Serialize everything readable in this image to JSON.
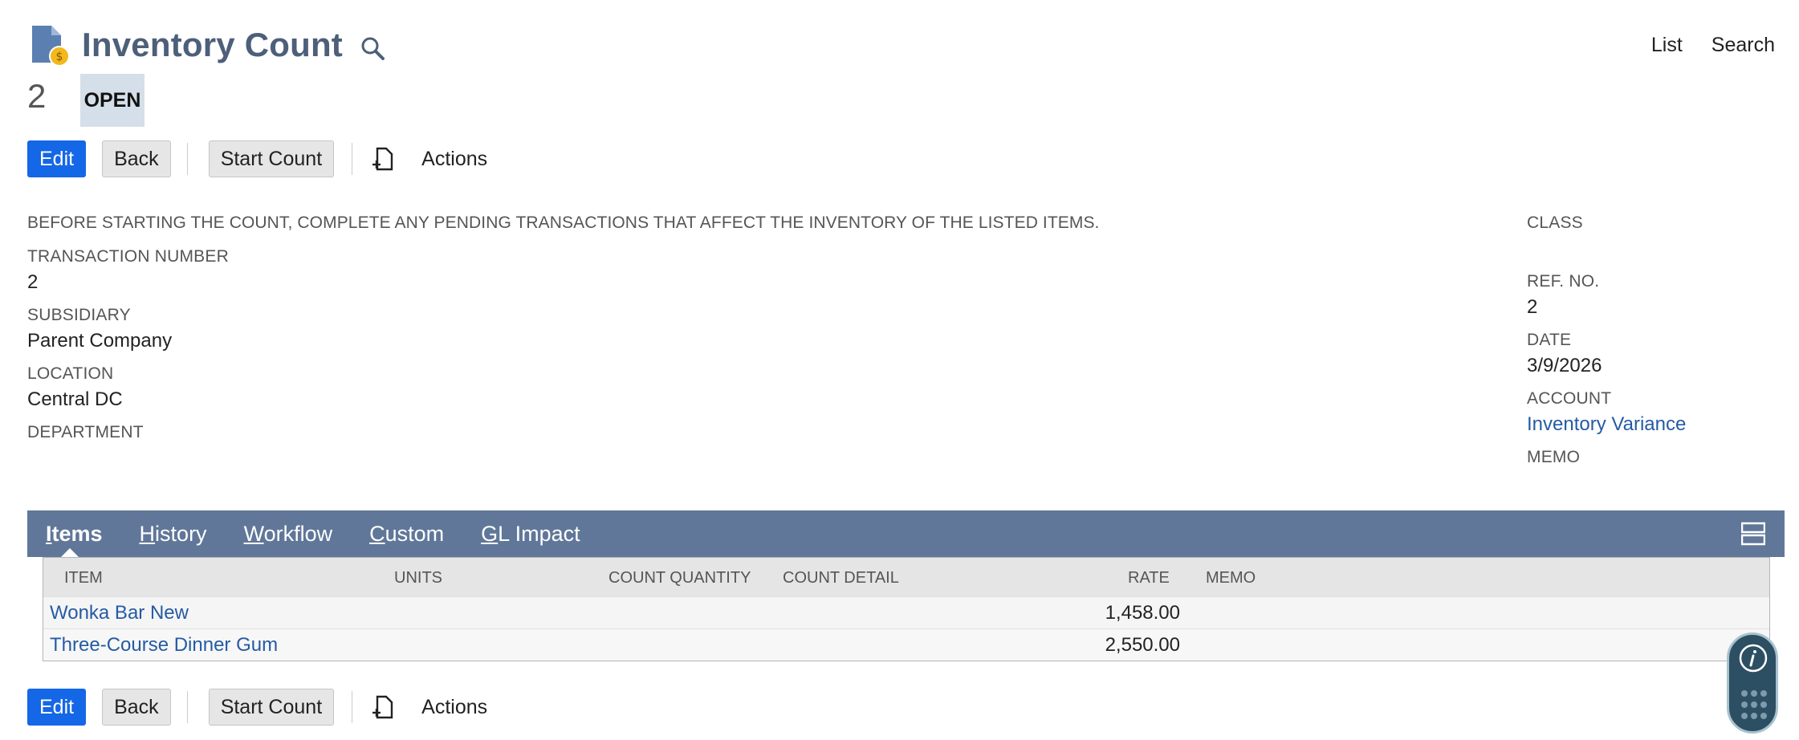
{
  "header": {
    "title": "Inventory Count",
    "record_id": "2",
    "status": "OPEN",
    "links": {
      "list": "List",
      "search": "Search"
    }
  },
  "toolbar": {
    "edit": "Edit",
    "back": "Back",
    "start_count": "Start Count",
    "actions": "Actions"
  },
  "notice": "BEFORE STARTING THE COUNT, COMPLETE ANY PENDING TRANSACTIONS THAT AFFECT THE INVENTORY OF THE LISTED ITEMS.",
  "fields_left": {
    "transaction_number": {
      "label": "TRANSACTION NUMBER",
      "value": "2"
    },
    "subsidiary": {
      "label": "SUBSIDIARY",
      "value": "Parent Company"
    },
    "location": {
      "label": "LOCATION",
      "value": "Central DC"
    },
    "department": {
      "label": "DEPARTMENT",
      "value": ""
    }
  },
  "fields_right": {
    "class": {
      "label": "CLASS",
      "value": ""
    },
    "ref_no": {
      "label": "REF. NO.",
      "value": "2"
    },
    "date": {
      "label": "DATE",
      "value": "3/9/2026"
    },
    "account": {
      "label": "ACCOUNT",
      "value": "Inventory Variance"
    },
    "memo": {
      "label": "MEMO",
      "value": ""
    }
  },
  "tabs": [
    {
      "first": "I",
      "rest": "tems",
      "active": true
    },
    {
      "first": "H",
      "rest": "istory",
      "active": false
    },
    {
      "first": "W",
      "rest": "orkflow",
      "active": false
    },
    {
      "first": "C",
      "rest": "ustom",
      "active": false
    },
    {
      "first": "G",
      "rest": "L Impact",
      "active": false
    }
  ],
  "table": {
    "columns": {
      "item": "ITEM",
      "units": "UNITS",
      "count_quantity": "COUNT QUANTITY",
      "count_detail": "COUNT DETAIL",
      "rate": "RATE",
      "memo": "MEMO"
    },
    "rows": [
      {
        "item": "Wonka Bar New",
        "units": "",
        "count_quantity": "",
        "count_detail": "",
        "rate": "1,458.00",
        "memo": ""
      },
      {
        "item": "Three-Course Dinner Gum",
        "units": "",
        "count_quantity": "",
        "count_detail": "",
        "rate": "2,550.00",
        "memo": ""
      }
    ]
  },
  "colors": {
    "primary_button": "#1467e6",
    "title": "#4d5f79",
    "tab_bar": "#607799",
    "link": "#255ba3",
    "status_badge": "#d5dfe9"
  }
}
